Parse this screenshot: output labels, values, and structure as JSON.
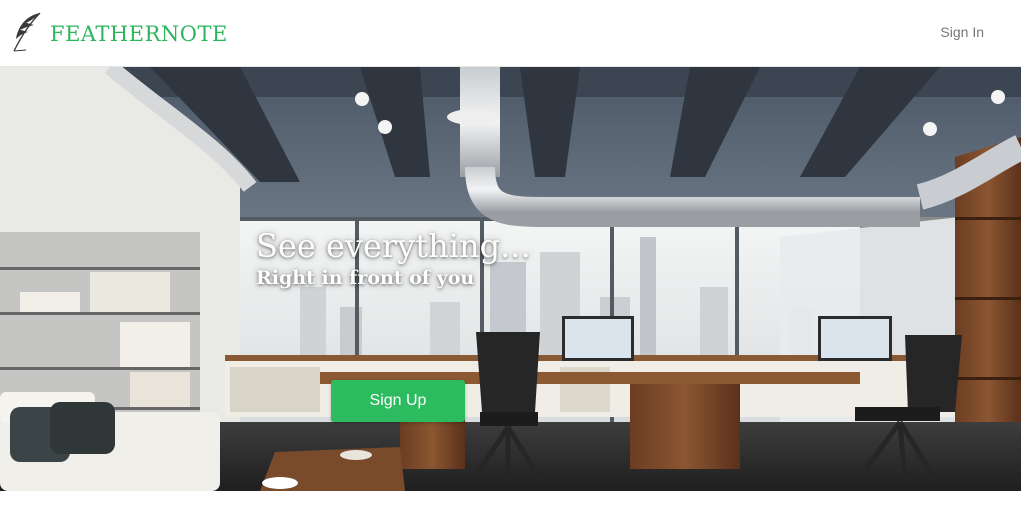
{
  "header": {
    "brand_name": "FEATHERNOTE",
    "logo_icon": "feather-quill-icon",
    "sign_in_label": "Sign In"
  },
  "hero": {
    "title": "See everything...",
    "subtitle": "Right in front of you",
    "sign_up_label": "Sign Up",
    "background": "office-loft-photo"
  },
  "colors": {
    "brand_green": "#2db55d",
    "button_green": "#2dbb5f",
    "nav_text": "#777777"
  }
}
